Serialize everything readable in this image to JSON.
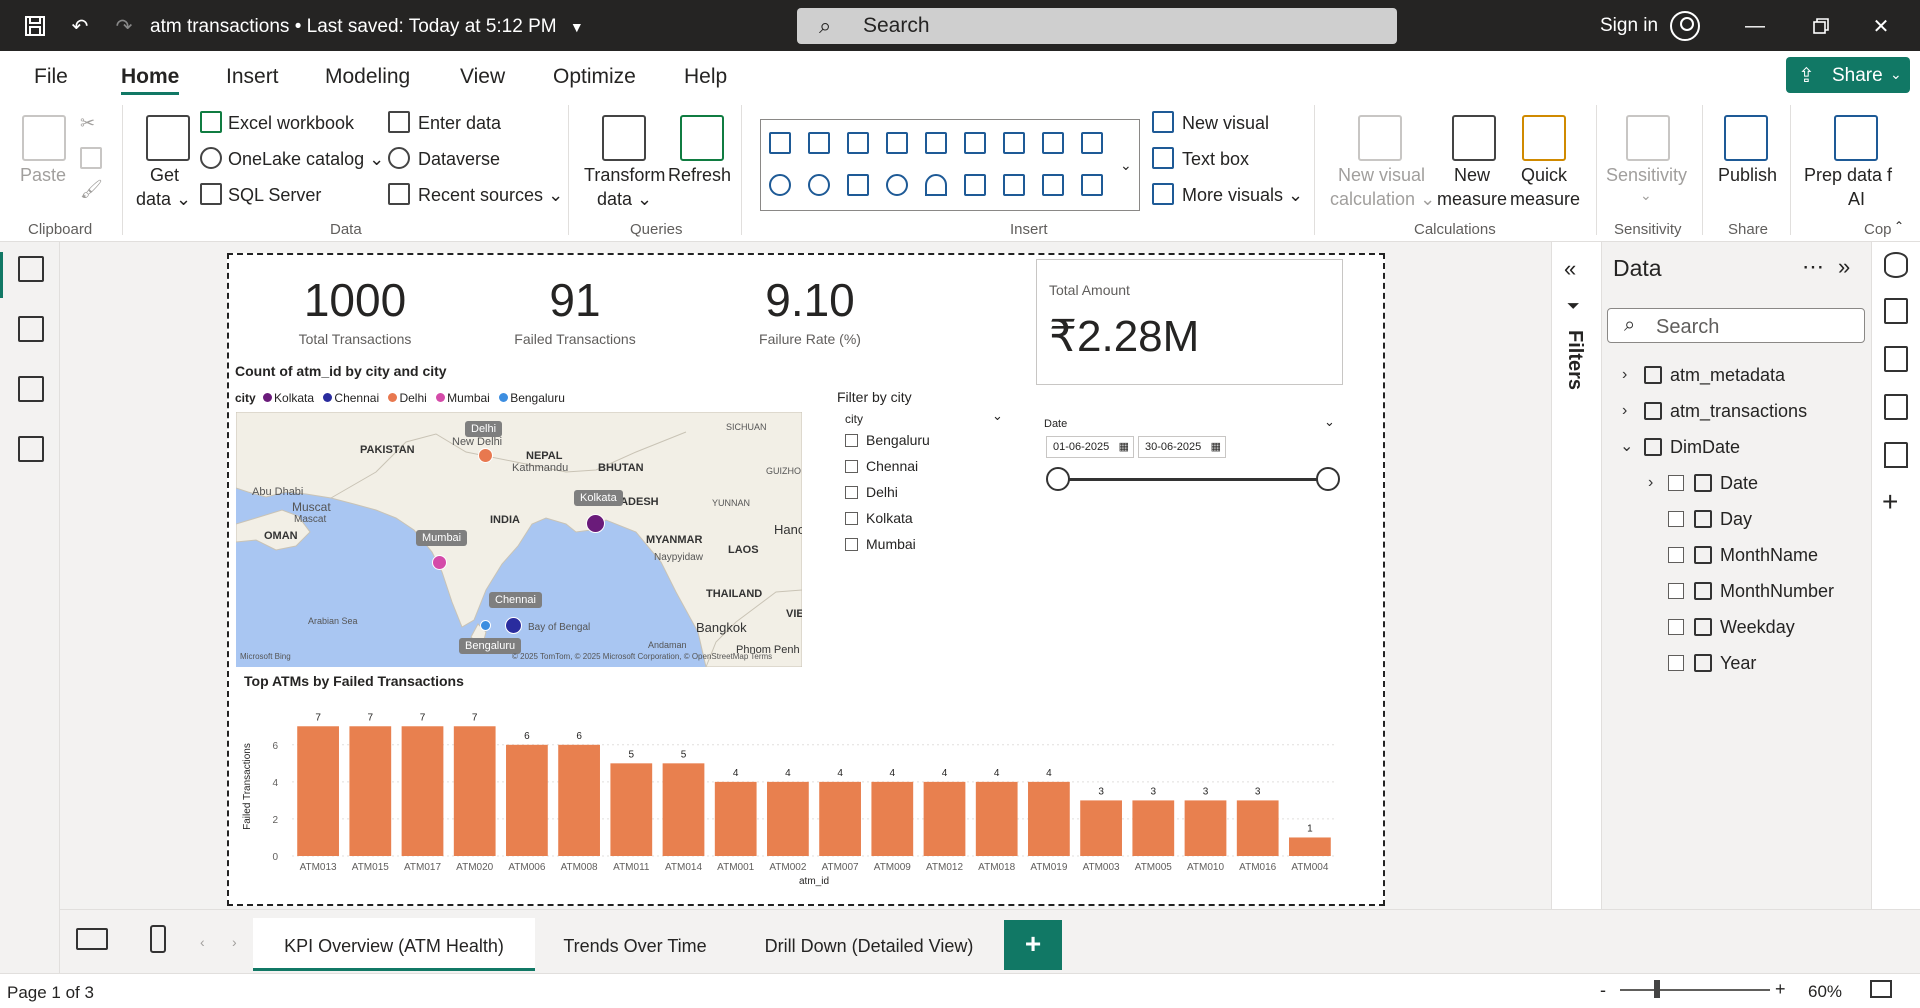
{
  "titlebar": {
    "file_title": "atm transactions",
    "saved_status": "Last saved: Today at 5:12 PM",
    "search_placeholder": "Search",
    "signin_label": "Sign in"
  },
  "ribbon_tabs": [
    "File",
    "Home",
    "Insert",
    "Modeling",
    "View",
    "Optimize",
    "Help"
  ],
  "share_label": "Share",
  "ribbon": {
    "clipboard": {
      "paste": "Paste",
      "group": "Clipboard"
    },
    "data": {
      "get_data_1": "Get",
      "get_data_2": "data",
      "excel": "Excel workbook",
      "onelake": "OneLake catalog",
      "sql": "SQL Server",
      "enter_data": "Enter data",
      "dataverse": "Dataverse",
      "recent": "Recent sources",
      "group": "Data"
    },
    "queries": {
      "transform_1": "Transform",
      "transform_2": "data",
      "refresh": "Refresh",
      "group": "Queries"
    },
    "insert": {
      "new_visual": "New visual",
      "text_box": "Text box",
      "more_visuals": "More visuals",
      "group": "Insert"
    },
    "calculations": {
      "new_visual_calc_1": "New visual",
      "new_visual_calc_2": "calculation",
      "new_measure_1": "New",
      "new_measure_2": "measure",
      "quick_measure_1": "Quick",
      "quick_measure_2": "measure",
      "group": "Calculations"
    },
    "sensitivity": {
      "label": "Sensitivity",
      "group": "Sensitivity"
    },
    "share": {
      "publish": "Publish",
      "group": "Share"
    },
    "ai": {
      "prep_1": "Prep data f",
      "prep_2": "AI",
      "group": "Cop"
    }
  },
  "kpis": [
    {
      "value": "1000",
      "label": "Total Transactions"
    },
    {
      "value": "91",
      "label": "Failed Transactions"
    },
    {
      "value": "9.10",
      "label": "Failure Rate (%)"
    }
  ],
  "card": {
    "label": "Total Amount",
    "value": "₹2.28M"
  },
  "map_visual": {
    "title": "Count of atm_id by city and city",
    "legend_title": "city",
    "legend": [
      {
        "name": "Kolkata",
        "color": "#6a1b7a"
      },
      {
        "name": "Chennai",
        "color": "#2a2c9e"
      },
      {
        "name": "Delhi",
        "color": "#e8784f"
      },
      {
        "name": "Mumbai",
        "color": "#d44ba9"
      },
      {
        "name": "Bengaluru",
        "color": "#3d8ee0"
      }
    ],
    "pins": [
      "Delhi",
      "Kolkata",
      "Mumbai",
      "Chennai",
      "Bengaluru"
    ],
    "places": [
      "PAKISTAN",
      "New Delhi",
      "NEPAL",
      "Kathmandu",
      "BHUTAN",
      "SICHUAN",
      "GUIZHO",
      "Abu Dhabi",
      "Muscat",
      "Mascat",
      "OMAN",
      "INDIA",
      "BANGLADESH",
      "YUNNAN",
      "MYANMAR",
      "Naypyidaw",
      "Hanoi",
      "LAOS",
      "THAILAND",
      "Bangkok",
      "Arabian Sea",
      "Bay of Bengal",
      "Andaman",
      "Phnom Penh",
      "VIE"
    ],
    "attribution": "© 2025 TomTom, © 2025 Microsoft Corporation, © OpenStreetMap  Terms",
    "bing": "Microsoft Bing"
  },
  "city_slicer": {
    "title": "Filter by city",
    "field": "city",
    "options": [
      "Bengaluru",
      "Chennai",
      "Delhi",
      "Kolkata",
      "Mumbai"
    ]
  },
  "date_slicer": {
    "label": "Date",
    "start": "01-06-2025",
    "end": "30-06-2025"
  },
  "chart_data": {
    "type": "bar",
    "title": "Top ATMs by Failed Transactions",
    "xlabel": "atm_id",
    "ylabel": "Failed Transactions",
    "categories": [
      "ATM013",
      "ATM015",
      "ATM017",
      "ATM020",
      "ATM006",
      "ATM008",
      "ATM011",
      "ATM014",
      "ATM001",
      "ATM002",
      "ATM007",
      "ATM009",
      "ATM012",
      "ATM018",
      "ATM019",
      "ATM003",
      "ATM005",
      "ATM010",
      "ATM016",
      "ATM004"
    ],
    "values": [
      7,
      7,
      7,
      7,
      6,
      6,
      5,
      5,
      4,
      4,
      4,
      4,
      4,
      4,
      4,
      3,
      3,
      3,
      3,
      1
    ],
    "yticks": [
      0,
      2,
      4,
      6
    ],
    "ylim": [
      0,
      7.5
    ],
    "color": "#e8804f"
  },
  "filters_label": "Filters",
  "data_pane": {
    "title": "Data",
    "search_placeholder": "Search",
    "tables": [
      "atm_metadata",
      "atm_transactions",
      "DimDate"
    ],
    "dimdate_fields": [
      "Date",
      "Day",
      "MonthName",
      "MonthNumber",
      "Weekday",
      "Year"
    ]
  },
  "page_tabs": [
    "KPI Overview (ATM Health)",
    "Trends Over Time",
    "Drill Down (Detailed View)"
  ],
  "add_page": "+",
  "status": {
    "page": "Page 1 of 3",
    "zoom": "60%",
    "zoom_minus": "-",
    "zoom_plus": "+"
  }
}
